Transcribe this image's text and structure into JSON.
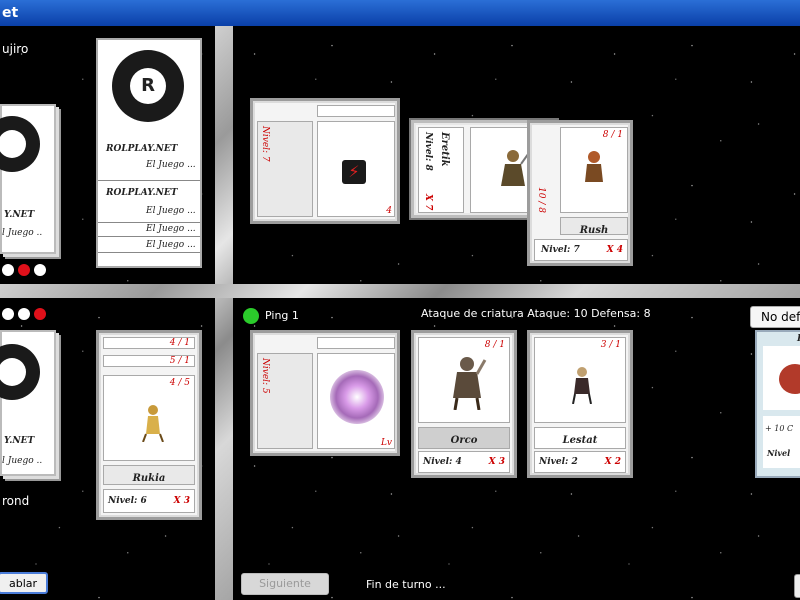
{
  "title": "et",
  "players": {
    "opponent_name": "ujiro",
    "self_name": "rond"
  },
  "deck_brand": {
    "line1": "ROLPLAY.NET",
    "line2": "El Juego ..."
  },
  "deck_small": {
    "line1": "Y.NET",
    "line2": "l Juego .."
  },
  "icons": {
    "logo_letter": "R"
  },
  "colors": {
    "dot_red": "#e0101a",
    "dot_white": "#ffffff",
    "ping_green": "#2bcc2b"
  },
  "top_field": {
    "card1": {
      "level": "Nivel: 7",
      "corner": "4"
    },
    "card2": {
      "name": "Eretik",
      "level": "Nivel: 8",
      "mult": "X 7",
      "stats": "10 / 8"
    },
    "card3": {
      "name": "Rush",
      "level": "Nivel: 7",
      "mult": "X 4",
      "stats": "8 / 1"
    }
  },
  "bottom_field": {
    "ping": "Ping 1",
    "attack_info": "Ataque de criatura  Ataque: 10 Defensa: 8",
    "card1": {
      "level": "Nivel: 5",
      "corner": "Lv"
    },
    "card2": {
      "name": "Orco",
      "level": "Nivel: 4",
      "mult": "X 3",
      "stats": "8 / 1"
    },
    "card3": {
      "name": "Lestat",
      "level": "Nivel: 2",
      "mult": "X 2",
      "stats": "3 / 1"
    },
    "no_def_button": "No def",
    "side_card": {
      "text": "+ 10 C",
      "level": "Nivel",
      "corner": "P"
    }
  },
  "hand_stack": {
    "stat1": "4 / 1",
    "stat2": "5 / 1",
    "stat3": "4 / 5",
    "name": "Rukia",
    "level": "Nivel: 6",
    "mult": "X 3"
  },
  "buttons": {
    "hablar": "ablar",
    "siguiente": "Siguiente"
  },
  "status": {
    "fin_turno": "Fin de turno ..."
  }
}
